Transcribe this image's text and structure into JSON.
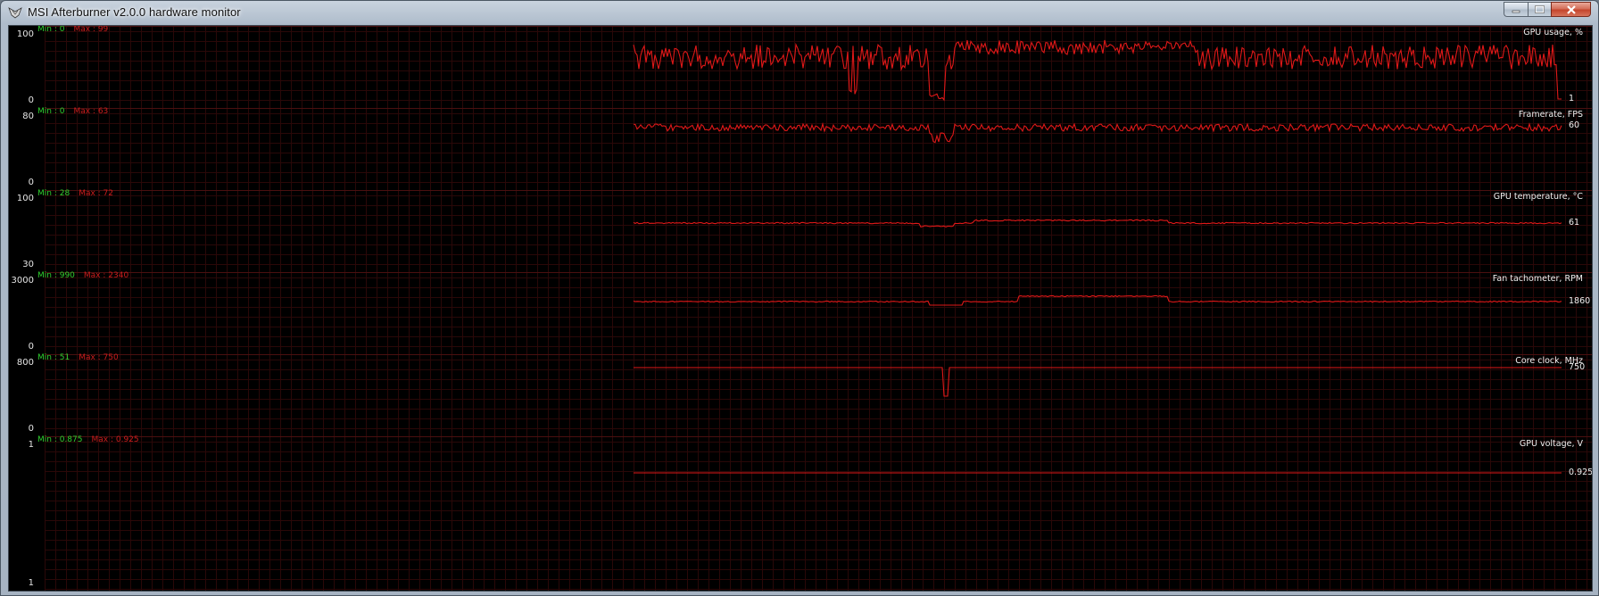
{
  "window": {
    "title": "MSI Afterburner v2.0.0 hardware monitor",
    "icon": "afterburner-app-icon",
    "controls": [
      "minimize-icon",
      "maximize-icon",
      "close-icon"
    ]
  },
  "colors": {
    "background": "#000000",
    "grid": "#3a0a0a",
    "trace": "#e01818",
    "min_label": "#2fd02f",
    "max_label": "#cc1d1d",
    "text": "#f0f0f0"
  },
  "panels": [
    {
      "title": "GPU usage, %",
      "ymax": "100",
      "ymin": "0",
      "min": "Min : 0",
      "max": "Max : 99",
      "current": "1"
    },
    {
      "title": "Framerate, FPS",
      "ymax": "80",
      "ymin": "0",
      "min": "Min : 0",
      "max": "Max : 63",
      "current": "60"
    },
    {
      "title": "GPU temperature, °C",
      "ymax": "100",
      "ymin": "30",
      "min": "Min : 28",
      "max": "Max : 72",
      "current": "61"
    },
    {
      "title": "Fan tachometer, RPM",
      "ymax": "3000",
      "ymin": "0",
      "min": "Min : 990",
      "max": "Max : 2340",
      "current": "1860"
    },
    {
      "title": "Core clock, MHz",
      "ymax": "800",
      "ymin": "0",
      "min": "Min : 51",
      "max": "Max : 750",
      "current": "750"
    },
    {
      "title": "GPU voltage, V",
      "ymax": "1",
      "ymin": "1",
      "min": "Min : 0.875",
      "max": "Max : 0.925",
      "current": "0.925"
    }
  ]
}
